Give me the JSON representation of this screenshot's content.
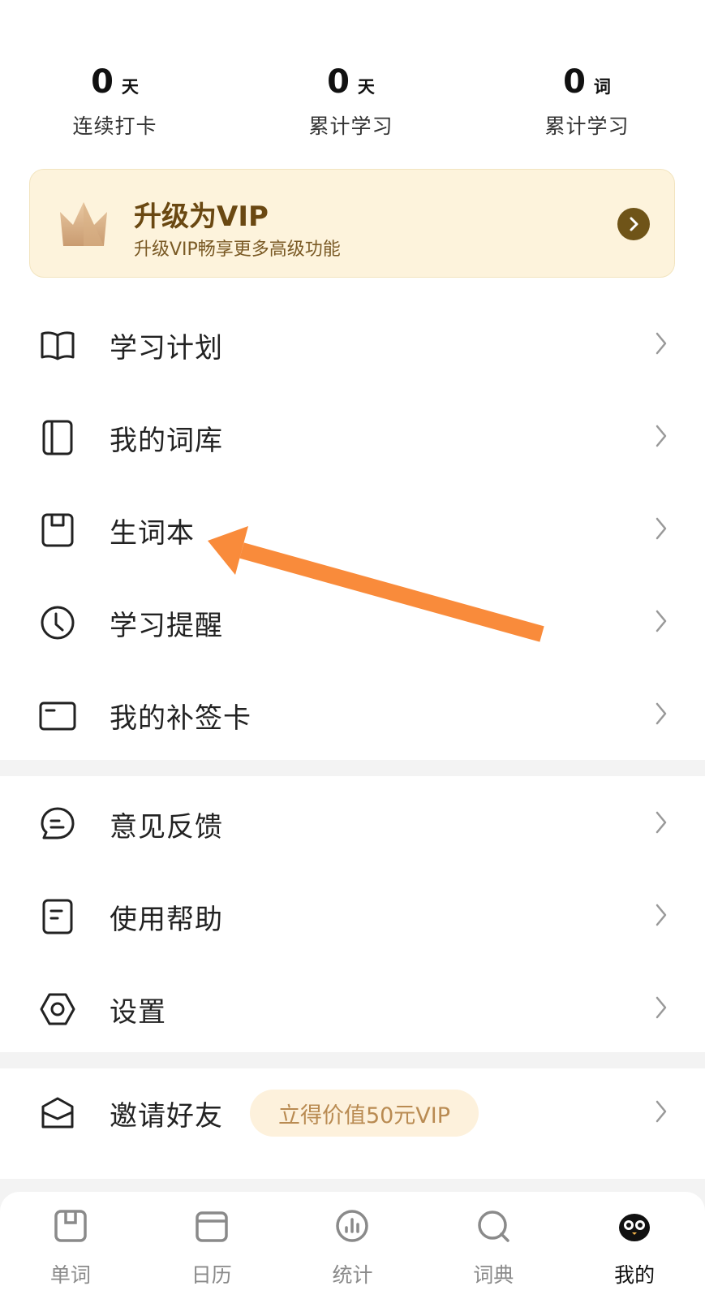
{
  "stats": [
    {
      "value": "0",
      "unit": "天",
      "label": "连续打卡"
    },
    {
      "value": "0",
      "unit": "天",
      "label": "累计学习"
    },
    {
      "value": "0",
      "unit": "词",
      "label": "累计学习"
    }
  ],
  "vip": {
    "title": "升级为VIP",
    "subtitle": "升级VIP畅享更多高级功能"
  },
  "menu1": [
    {
      "label": "学习计划",
      "icon": "book-open-icon"
    },
    {
      "label": "我的词库",
      "icon": "word-library-icon"
    },
    {
      "label": "生词本",
      "icon": "notebook-icon"
    },
    {
      "label": "学习提醒",
      "icon": "clock-icon"
    },
    {
      "label": "我的补签卡",
      "icon": "card-icon"
    }
  ],
  "menu2": [
    {
      "label": "意见反馈",
      "icon": "chat-bubble-icon"
    },
    {
      "label": "使用帮助",
      "icon": "help-doc-icon"
    },
    {
      "label": "设置",
      "icon": "settings-hex-icon"
    }
  ],
  "invite": {
    "label": "邀请好友",
    "badge": "立得价值50元VIP"
  },
  "nav": [
    {
      "label": "单词",
      "icon": "word-tab-icon"
    },
    {
      "label": "日历",
      "icon": "calendar-icon"
    },
    {
      "label": "统计",
      "icon": "stats-icon"
    },
    {
      "label": "词典",
      "icon": "dictionary-search-icon"
    },
    {
      "label": "我的",
      "icon": "mascot-profile-icon"
    }
  ],
  "colors": {
    "vip_bg": "#fdf3dc",
    "vip_text": "#6a4812",
    "annotation_arrow": "#f98b3b",
    "badge_text": "#b98b52"
  }
}
